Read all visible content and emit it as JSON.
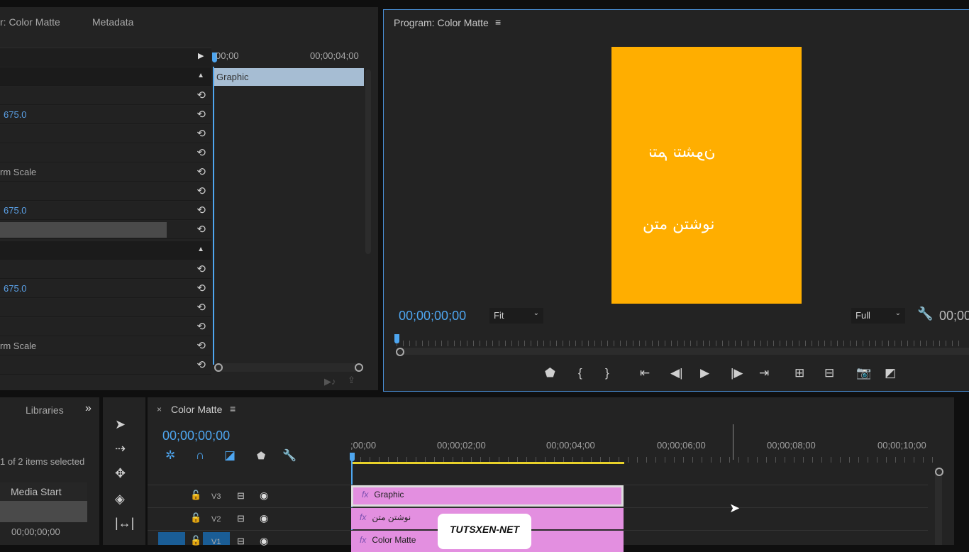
{
  "effect_controls": {
    "tab_source": "r: Color Matte",
    "tab_metadata": "Metadata",
    "ruler_start": "00;00",
    "ruler_end": "00;00;04;00",
    "clip_name": "Graphic",
    "rows": [
      {
        "type": "header"
      },
      {
        "text": ""
      },
      {
        "text": "675.0",
        "kind": "value"
      },
      {
        "text": ""
      },
      {
        "text": ""
      },
      {
        "text": "rm Scale",
        "kind": "label"
      },
      {
        "text": ""
      },
      {
        "text": "675.0",
        "kind": "value"
      },
      {
        "text": "",
        "kind": "slider"
      },
      {
        "type": "header"
      },
      {
        "text": ""
      },
      {
        "text": "675.0",
        "kind": "value"
      },
      {
        "text": ""
      },
      {
        "text": ""
      },
      {
        "text": "rm Scale",
        "kind": "label"
      },
      {
        "text": ""
      }
    ]
  },
  "program": {
    "title": "Program: Color Matte",
    "frame_color": "#ffae00",
    "text_mirrored": "نتم نتشون",
    "text": "نوشتن متن",
    "timecode": "00;00;00;00",
    "zoom": "Fit",
    "resolution": "Full",
    "timecode_right": "00;00"
  },
  "project": {
    "tab": "Libraries",
    "selection": "1 of 2 items selected",
    "column": "Media Start",
    "cell": "00;00;00;00"
  },
  "timeline": {
    "title": "Color Matte",
    "timecode": "00;00;00;00",
    "ticks": [
      ";00;00",
      "00;00;02;00",
      "00;00;04;00",
      "00;00;06;00",
      "00;00;08;00",
      "00;00;10;00"
    ],
    "tracks": [
      {
        "name": "V3",
        "clip": "Graphic"
      },
      {
        "name": "V2",
        "clip": "نوشتن متن"
      },
      {
        "name": "V1",
        "clip": "Color Matte"
      }
    ],
    "clip_color": "#e38fe0",
    "work_area_color": "#e8d12a"
  },
  "watermark": "TUTSXEN-NET",
  "accent": "#4ea6f0"
}
